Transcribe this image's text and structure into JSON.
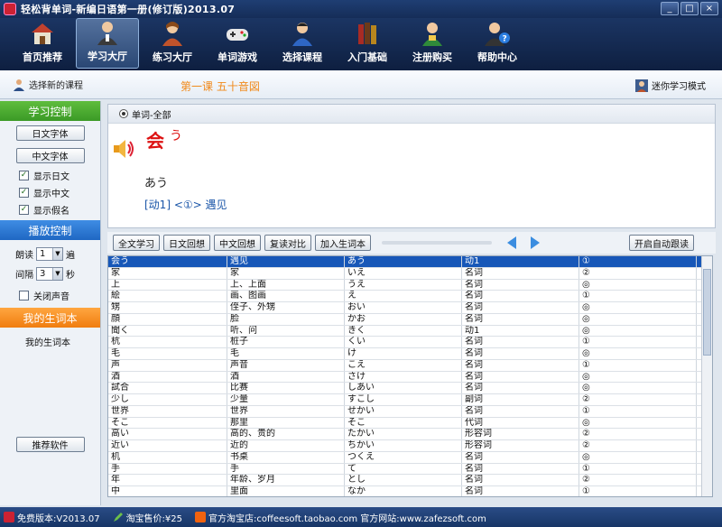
{
  "window": {
    "title": "轻松背单词-新编日语第一册(修订版)2013.07",
    "buttons": [
      "_",
      "□",
      "×"
    ]
  },
  "toolbar": {
    "items": [
      {
        "label": "首页推荐",
        "icon": "house-icon"
      },
      {
        "label": "学习大厅",
        "icon": "teacher-icon"
      },
      {
        "label": "练习大厅",
        "icon": "student-icon"
      },
      {
        "label": "单词游戏",
        "icon": "gamepad-icon"
      },
      {
        "label": "选择课程",
        "icon": "person-icon"
      },
      {
        "label": "入门基础",
        "icon": "books-icon"
      },
      {
        "label": "注册购买",
        "icon": "wallet-icon"
      },
      {
        "label": "帮助中心",
        "icon": "help-icon"
      }
    ]
  },
  "subheader": {
    "select_course": "选择新的课程",
    "lesson_title": "第一课  五十音図",
    "mini_mode": "迷你学习模式"
  },
  "leftpanel": {
    "study_control": "学习控制",
    "jp_font": "日文字体",
    "cn_font": "中文字体",
    "show_jp": "显示日文",
    "show_cn": "显示中文",
    "show_kana": "显示假名",
    "play_control": "播放控制",
    "read_label": "朗读",
    "read_value": "1",
    "read_unit": "遍",
    "interval_label": "间隔",
    "interval_value": "3",
    "interval_unit": "秒",
    "mute": "关闭声音",
    "vocab_head": "我的生词本",
    "vocab_item": "我的生词本",
    "recommend": "推荐软件"
  },
  "word": {
    "filter": "单词-全部",
    "kanji": "会",
    "ruby": "う",
    "reading": "あう",
    "meaning": "[动1] <①> 遇见"
  },
  "controls": {
    "full_study": "全文学习",
    "jp_review": "日文回想",
    "cn_review": "中文回想",
    "compare": "复读对比",
    "add_vocab": "加入生词本",
    "auto_read": "开启自动跟读"
  },
  "rows": [
    [
      "会う",
      "遇见",
      "あう",
      "动1",
      "①"
    ],
    [
      "家",
      "家",
      "いえ",
      "名词",
      "②"
    ],
    [
      "上",
      "上、上面",
      "うえ",
      "名词",
      "◎"
    ],
    [
      "絵",
      "画、图画",
      "え",
      "名词",
      "①"
    ],
    [
      "甥",
      "侄子、外甥",
      "おい",
      "名词",
      "◎"
    ],
    [
      "顔",
      "脸",
      "かお",
      "名词",
      "◎"
    ],
    [
      "聞く",
      "听、问",
      "きく",
      "动1",
      "◎"
    ],
    [
      "杭",
      "桩子",
      "くい",
      "名词",
      "①"
    ],
    [
      "毛",
      "毛",
      "け",
      "名词",
      "◎"
    ],
    [
      "声",
      "声音",
      "こえ",
      "名词",
      "①"
    ],
    [
      "酒",
      "酒",
      "さけ",
      "名词",
      "◎"
    ],
    [
      "試合",
      "比赛",
      "しあい",
      "名词",
      "◎"
    ],
    [
      "少し",
      "少量",
      "すこし",
      "副词",
      "②"
    ],
    [
      "世界",
      "世界",
      "せかい",
      "名词",
      "①"
    ],
    [
      "そこ",
      "那里",
      "そこ",
      "代词",
      "◎"
    ],
    [
      "高い",
      "高的、贵的",
      "たかい",
      "形容词",
      "②"
    ],
    [
      "近い",
      "近的",
      "ちかい",
      "形容词",
      "②"
    ],
    [
      "机",
      "书桌",
      "つくえ",
      "名词",
      "◎"
    ],
    [
      "手",
      "手",
      "て",
      "名词",
      "①"
    ],
    [
      "年",
      "年龄、岁月",
      "とし",
      "名词",
      "②"
    ],
    [
      "中",
      "里面",
      "なか",
      "名词",
      "①"
    ]
  ],
  "statusbar": {
    "version": "免费版本:V2013.07",
    "price": "淘宝售价:¥25",
    "store": "官方淘宝店:coffeesoft.taobao.com  官方网站:www.zafezsoft.com"
  },
  "colors": {
    "accent_green": "#3b9a26",
    "accent_blue": "#1f67c3",
    "accent_orange": "#f07d0f",
    "selected_row": "#1757b8",
    "kanji_red": "#dd1111"
  }
}
